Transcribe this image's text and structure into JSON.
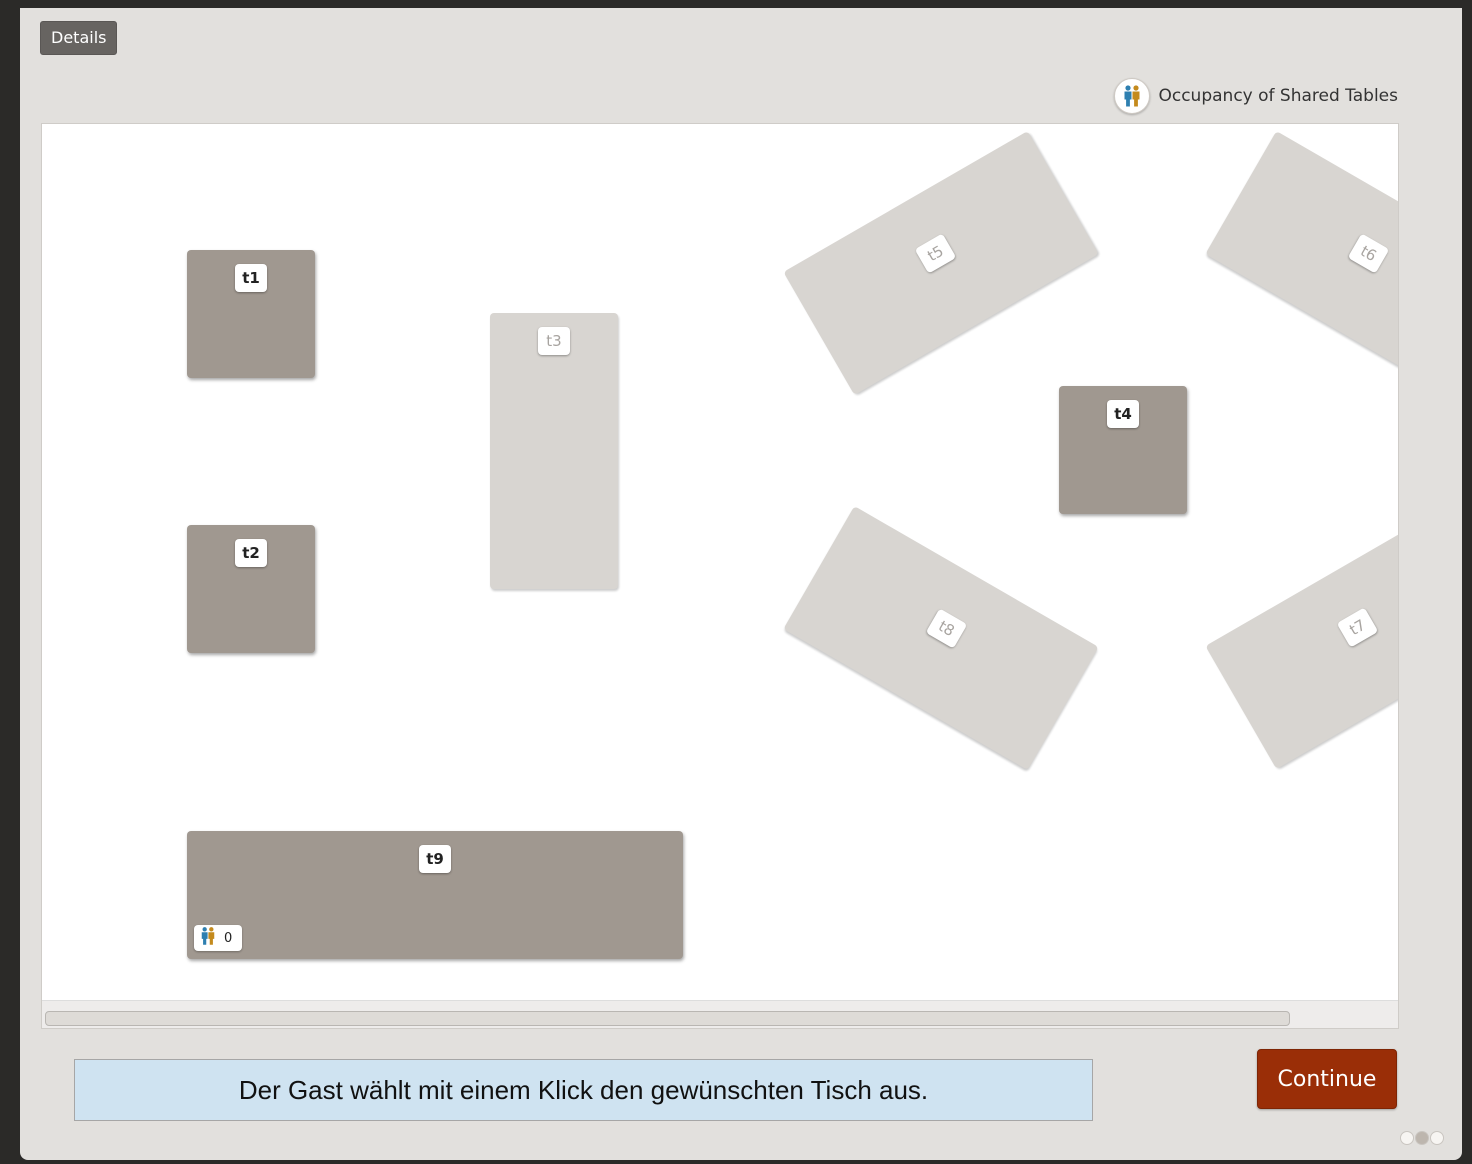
{
  "toolbar": {
    "details_label": "Details"
  },
  "legend": {
    "occupancy_label": "Occupancy of Shared Tables",
    "icon": "people-icon"
  },
  "tables": [
    {
      "id": "t1",
      "label": "t1",
      "status": "available"
    },
    {
      "id": "t2",
      "label": "t2",
      "status": "available"
    },
    {
      "id": "t3",
      "label": "t3",
      "status": "unavailable"
    },
    {
      "id": "t4",
      "label": "t4",
      "status": "available"
    },
    {
      "id": "t5",
      "label": "t5",
      "status": "unavailable"
    },
    {
      "id": "t6",
      "label": "t6",
      "status": "unavailable"
    },
    {
      "id": "t7",
      "label": "t7",
      "status": "unavailable"
    },
    {
      "id": "t8",
      "label": "t8",
      "status": "unavailable"
    },
    {
      "id": "t9",
      "label": "t9",
      "status": "available",
      "shared_occupancy": "0"
    }
  ],
  "instruction": {
    "text": "Der Gast wählt mit einem Klick den gewünschten Tisch aus."
  },
  "actions": {
    "continue_label": "Continue"
  },
  "pagination": {
    "total": 3,
    "current": 2
  },
  "colors": {
    "table_available": "#a09890",
    "table_unavailable": "#d8d5d1",
    "continue_button": "#9a2e07",
    "instruction_bg": "#cfe3f1"
  }
}
